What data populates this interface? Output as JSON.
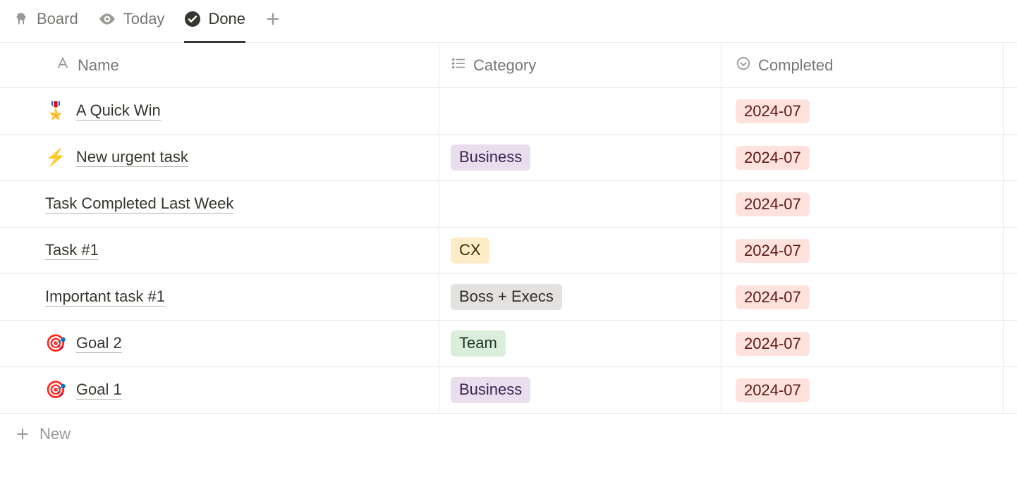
{
  "tabs": {
    "board": "Board",
    "today": "Today",
    "done": "Done"
  },
  "columns": {
    "name": "Name",
    "category": "Category",
    "completed": "Completed"
  },
  "rows": [
    {
      "emoji": "🎖️",
      "title": "A Quick Win",
      "category": null,
      "category_color": null,
      "completed": "2024-07"
    },
    {
      "emoji": "⚡",
      "title": "New urgent task",
      "category": "Business",
      "category_color": "purple",
      "completed": "2024-07"
    },
    {
      "emoji": "",
      "title": "Task Completed Last Week",
      "category": null,
      "category_color": null,
      "completed": "2024-07"
    },
    {
      "emoji": "",
      "title": "Task #1",
      "category": "CX",
      "category_color": "yellow",
      "completed": "2024-07"
    },
    {
      "emoji": "",
      "title": "Important task #1",
      "category": "Boss + Execs",
      "category_color": "gray",
      "completed": "2024-07"
    },
    {
      "emoji": "🎯",
      "title": "Goal 2",
      "category": "Team",
      "category_color": "green",
      "completed": "2024-07"
    },
    {
      "emoji": "🎯",
      "title": "Goal 1",
      "category": "Business",
      "category_color": "purple",
      "completed": "2024-07"
    }
  ],
  "new_row_label": "New"
}
